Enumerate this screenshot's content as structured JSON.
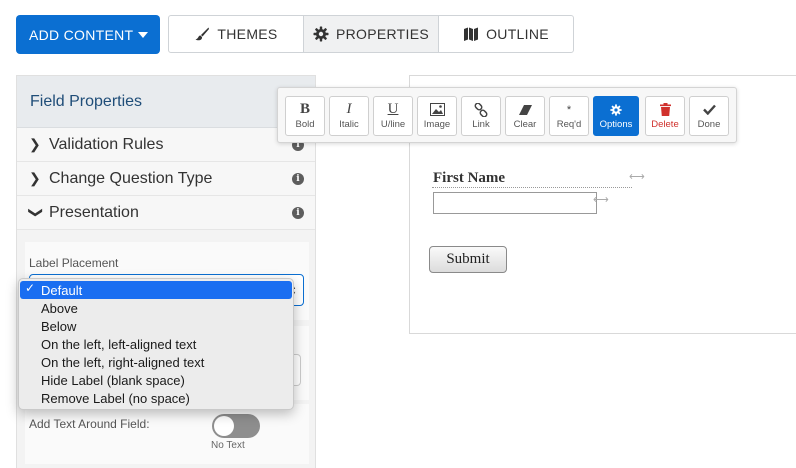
{
  "topbar": {
    "add_content_label": "ADD CONTENT",
    "tabs": [
      {
        "label": "THEMES",
        "icon": "brush-icon"
      },
      {
        "label": "PROPERTIES",
        "icon": "gear-icon"
      },
      {
        "label": "OUTLINE",
        "icon": "map-icon"
      }
    ],
    "active_tab": "PROPERTIES"
  },
  "panel": {
    "title": "Field Properties",
    "sections": [
      {
        "label": "Validation Rules",
        "expanded": false
      },
      {
        "label": "Change Question Type",
        "expanded": false
      },
      {
        "label": "Presentation",
        "expanded": true
      }
    ],
    "label_placement": {
      "label": "Label Placement",
      "selected": "Default",
      "options": [
        "Default",
        "Above",
        "Below",
        "On the left, left-aligned text",
        "On the left, right-aligned text",
        "Hide Label (blank space)",
        "Remove Label (no space)"
      ]
    },
    "add_text_around_field": {
      "label": "Add Text Around Field:",
      "toggle_state": "off",
      "toggle_text": "No Text"
    }
  },
  "toolbar": {
    "buttons": [
      {
        "glyph": "B",
        "label": "Bold",
        "icon": "bold-icon"
      },
      {
        "glyph": "I",
        "label": "Italic",
        "icon": "italic-icon"
      },
      {
        "glyph": "U",
        "label": "U/line",
        "icon": "underline-icon"
      },
      {
        "glyph": "",
        "label": "Image",
        "icon": "image-icon"
      },
      {
        "glyph": "",
        "label": "Link",
        "icon": "link-icon"
      },
      {
        "glyph": "",
        "label": "Clear",
        "icon": "eraser-icon"
      },
      {
        "glyph": "*",
        "label": "Req'd",
        "icon": "asterisk-icon"
      },
      {
        "glyph": "",
        "label": "Options",
        "icon": "gear-icon"
      },
      {
        "glyph": "",
        "label": "Delete",
        "icon": "trash-icon"
      },
      {
        "glyph": "",
        "label": "Done",
        "icon": "checkmark-icon"
      }
    ],
    "active_button": "Options"
  },
  "form": {
    "field_label": "First Name",
    "submit_label": "Submit"
  },
  "colors": {
    "primary": "#0b6fd2",
    "menu_highlight": "#1a6ef1",
    "danger": "#d0312d",
    "panel_title": "#1f4d78"
  }
}
